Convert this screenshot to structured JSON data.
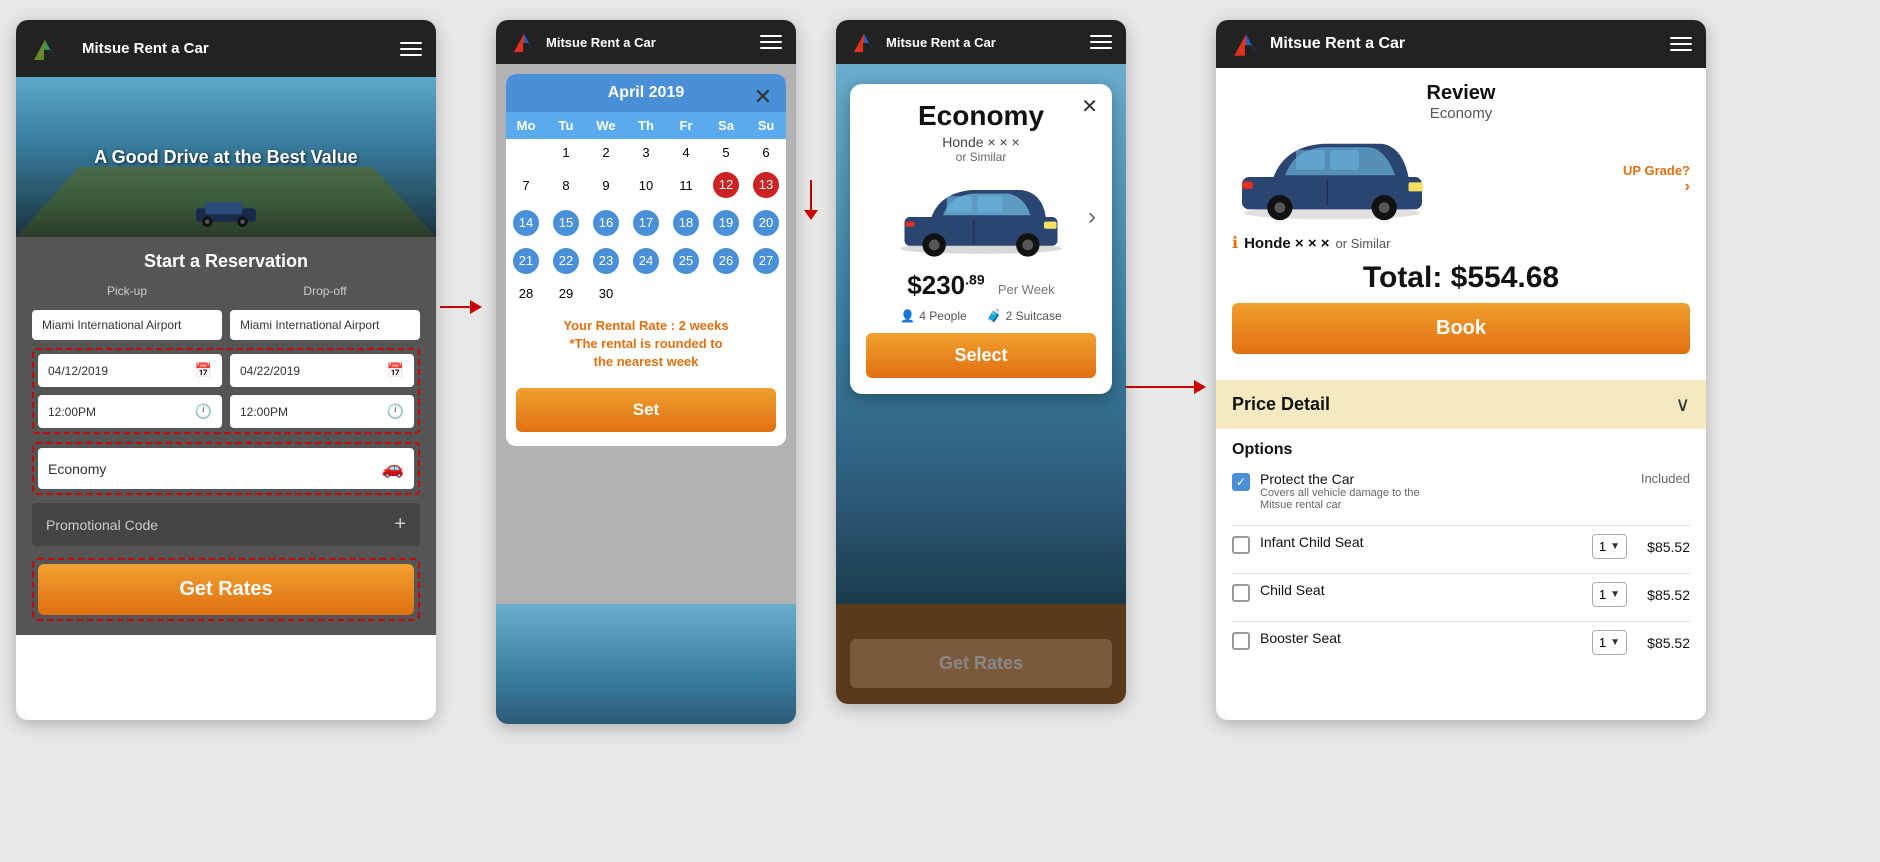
{
  "app": {
    "name": "Mitsue Rent a Car",
    "hamburger_label": "☰"
  },
  "phone1": {
    "hero_text": "A Good Drive at the Best Value",
    "reservation_title": "Start a Reservation",
    "pickup_label": "Pick-up",
    "dropoff_label": "Drop-off",
    "pickup_location": "Miami International Airport",
    "dropoff_location": "Miami International Airport",
    "pickup_date": "04/12/2019",
    "dropoff_date": "04/22/2019",
    "pickup_time": "12:00PM",
    "dropoff_time": "12:00PM",
    "vehicle_class": "Economy",
    "promo_label": "Promotional Code",
    "promo_plus": "+",
    "get_rates_label": "Get Rates"
  },
  "phone2": {
    "modal_title": "April 2019",
    "close_icon": "✕",
    "days": [
      "Mo",
      "Tu",
      "We",
      "Th",
      "Fr",
      "Sa",
      "Su"
    ],
    "rental_note_line1": "Your Rental Rate : 2 weeks",
    "rental_note_line2": "*The rental is rounded to",
    "rental_note_line3": "the nearest week",
    "set_label": "Set",
    "week1": [
      {
        "day": "",
        "type": "empty"
      },
      {
        "day": "",
        "type": "empty"
      },
      {
        "day": "",
        "type": "empty"
      },
      {
        "day": "",
        "type": "empty"
      },
      {
        "day": "",
        "type": "empty"
      },
      {
        "day": "",
        "type": "empty"
      },
      {
        "day": "",
        "type": "empty"
      }
    ],
    "row1": [
      {
        "day": "",
        "t": ""
      },
      {
        "day": "1",
        "t": ""
      },
      {
        "day": "2",
        "t": ""
      },
      {
        "day": "3",
        "t": ""
      },
      {
        "day": "4",
        "t": ""
      },
      {
        "day": "5",
        "t": ""
      },
      {
        "day": "6",
        "t": ""
      }
    ],
    "row2": [
      {
        "day": "7",
        "t": ""
      },
      {
        "day": "8",
        "t": ""
      },
      {
        "day": "9",
        "t": ""
      },
      {
        "day": "10",
        "t": ""
      },
      {
        "day": "11",
        "t": ""
      },
      {
        "day": "12",
        "t": "red"
      },
      {
        "day": "13",
        "t": "red"
      }
    ],
    "row3": [
      {
        "day": "14",
        "t": "blue"
      },
      {
        "day": "15",
        "t": "blue"
      },
      {
        "day": "16",
        "t": "blue"
      },
      {
        "day": "17",
        "t": "blue"
      },
      {
        "day": "18",
        "t": "blue"
      },
      {
        "day": "19",
        "t": "blue"
      },
      {
        "day": "20",
        "t": "blue"
      }
    ],
    "row4": [
      {
        "day": "21",
        "t": "blue"
      },
      {
        "day": "22",
        "t": "blue"
      },
      {
        "day": "23",
        "t": "blue"
      },
      {
        "day": "24",
        "t": "blue"
      },
      {
        "day": "25",
        "t": "blue"
      },
      {
        "day": "26",
        "t": "blue"
      },
      {
        "day": "27",
        "t": "blue"
      }
    ],
    "row5": [
      {
        "day": "28",
        "t": ""
      },
      {
        "day": "29",
        "t": ""
      },
      {
        "day": "30",
        "t": ""
      },
      {
        "day": "",
        "t": ""
      },
      {
        "day": "",
        "t": ""
      },
      {
        "day": "",
        "t": ""
      },
      {
        "day": "",
        "t": ""
      }
    ]
  },
  "phone3": {
    "car_class": "Economy",
    "car_model": "Honde × × ×",
    "car_similar": "or Similar",
    "car_price": "$230",
    "car_price_cents": ".89",
    "car_price_period": "Per Week",
    "car_people": "4 People",
    "car_suitcases": "2 Suitcase",
    "select_label": "Select",
    "get_rates_label": "Get Rates",
    "close_icon": "✕",
    "next_icon": "›"
  },
  "phone4": {
    "review_title": "Review",
    "review_subtitle": "Economy",
    "upgrade_label": "UP Grade?",
    "upgrade_chevron": "›",
    "car_model": "Honde × × ×",
    "car_similar": "or Similar",
    "total_label": "Total: $554.68",
    "book_label": "Book",
    "price_detail_label": "Price Detail",
    "price_detail_chevron": "∨",
    "options_title": "Options",
    "options": [
      {
        "name": "Protect the Car",
        "desc": "Covers all vehicle damage to the Mitsue rental car",
        "checked": true,
        "price": "Included",
        "is_included": true,
        "qty": null
      },
      {
        "name": "Infant Child Seat",
        "checked": false,
        "price": "$85.52",
        "is_included": false,
        "qty": "1"
      },
      {
        "name": "Child Seat",
        "checked": false,
        "price": "$85.52",
        "is_included": false,
        "qty": "1"
      },
      {
        "name": "Booster Seat",
        "checked": false,
        "price": "$85.52",
        "is_included": false,
        "qty": "1"
      }
    ]
  },
  "arrows": {
    "color": "#cc0000"
  }
}
